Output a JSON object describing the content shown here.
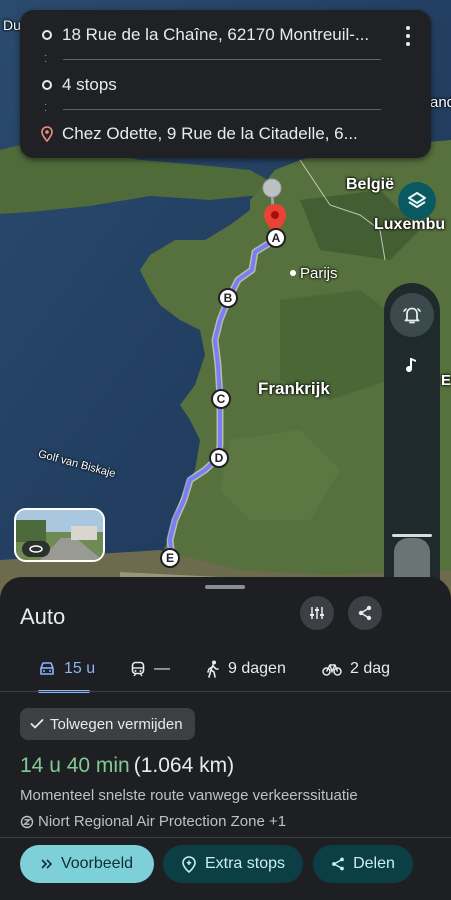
{
  "map": {
    "labels": {
      "belgium": "België",
      "luxembourg": "Luxembu",
      "paris": "Parijs",
      "france": "Frankrijk",
      "biscay": "Golf van Biskaje",
      "top_left": "Du",
      "top_right": "and",
      "right_edge": "Ev"
    },
    "markers": [
      "A",
      "B",
      "C",
      "D",
      "E"
    ]
  },
  "route_card": {
    "origin": "18 Rue de la Chaîne, 62170 Montreuil-...",
    "stops": "4 stops",
    "destination": "Chez Odette, 9 Rue de la Citadelle, 6..."
  },
  "sheet": {
    "title": "Auto",
    "tabs": [
      {
        "label": "15 u",
        "icon": "car-icon",
        "active": true
      },
      {
        "label": "—",
        "icon": "train-icon",
        "active": false
      },
      {
        "label": "9 dagen",
        "icon": "walk-icon",
        "active": false
      },
      {
        "label": "2 dag",
        "icon": "bike-icon",
        "active": false
      }
    ],
    "chip": "Tolwegen vermijden",
    "duration": "14 u 40 min",
    "distance": "(1.064 km)",
    "description": "Momenteel snelste route vanwege verkeerssituatie",
    "zone": "Niort Regional Air Protection Zone +1",
    "buttons": {
      "preview": "Voorbeeld",
      "add_stops": "Extra stops",
      "share": "Delen"
    }
  },
  "colors": {
    "accent": "#8ab4f8",
    "duration_green": "#81c995",
    "route": "#7b7df7",
    "pin": "#ea4335"
  }
}
